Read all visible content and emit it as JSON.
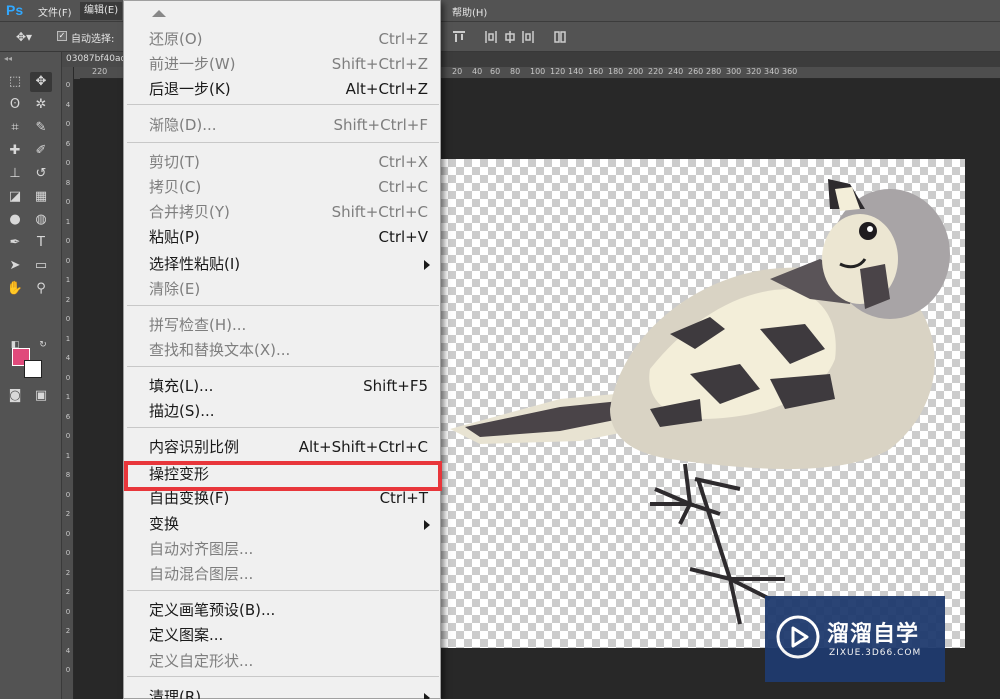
{
  "menubar": {
    "logo": "Ps",
    "items": [
      "文件(F)",
      "编辑(E)",
      "帮助(H)"
    ]
  },
  "options_bar": {
    "auto_select_label": "自动选择:"
  },
  "document_tab": {
    "title": "03087bf40ad"
  },
  "ruler_top": [
    "220",
    "20",
    "40",
    "60",
    "80",
    "100",
    "120",
    "140",
    "160",
    "180",
    "200",
    "220",
    "240",
    "260",
    "280",
    "300",
    "320",
    "340",
    "360"
  ],
  "ruler_left": [
    "0",
    "4",
    "0",
    "6",
    "0",
    "8",
    "0",
    "1",
    "0",
    "0",
    "1",
    "2",
    "0",
    "1",
    "4",
    "0",
    "1",
    "6",
    "0",
    "1",
    "8",
    "0",
    "2",
    "0",
    "0",
    "2",
    "2",
    "0",
    "2",
    "4",
    "0"
  ],
  "edit_menu": {
    "items": [
      {
        "label": "还原(O)",
        "shortcut": "Ctrl+Z",
        "enabled": false
      },
      {
        "label": "前进一步(W)",
        "shortcut": "Shift+Ctrl+Z",
        "enabled": false
      },
      {
        "label": "后退一步(K)",
        "shortcut": "Alt+Ctrl+Z",
        "enabled": true
      },
      {
        "label": "渐隐(D)...",
        "shortcut": "Shift+Ctrl+F",
        "enabled": false
      },
      {
        "label": "剪切(T)",
        "shortcut": "Ctrl+X",
        "enabled": false
      },
      {
        "label": "拷贝(C)",
        "shortcut": "Ctrl+C",
        "enabled": false
      },
      {
        "label": "合并拷贝(Y)",
        "shortcut": "Shift+Ctrl+C",
        "enabled": false
      },
      {
        "label": "粘贴(P)",
        "shortcut": "Ctrl+V",
        "enabled": true
      },
      {
        "label": "选择性粘贴(I)",
        "shortcut": "",
        "enabled": true,
        "submenu": true
      },
      {
        "label": "清除(E)",
        "shortcut": "",
        "enabled": false
      },
      {
        "label": "拼写检查(H)...",
        "shortcut": "",
        "enabled": false
      },
      {
        "label": "查找和替换文本(X)...",
        "shortcut": "",
        "enabled": false
      },
      {
        "label": "填充(L)...",
        "shortcut": "Shift+F5",
        "enabled": true
      },
      {
        "label": "描边(S)...",
        "shortcut": "",
        "enabled": true
      },
      {
        "label": "内容识别比例",
        "shortcut": "Alt+Shift+Ctrl+C",
        "enabled": true
      },
      {
        "label": "操控变形",
        "shortcut": "",
        "enabled": true,
        "highlighted": true
      },
      {
        "label": "自由变换(F)",
        "shortcut": "Ctrl+T",
        "enabled": true
      },
      {
        "label": "变换",
        "shortcut": "",
        "enabled": true,
        "submenu": true
      },
      {
        "label": "自动对齐图层...",
        "shortcut": "",
        "enabled": false
      },
      {
        "label": "自动混合图层...",
        "shortcut": "",
        "enabled": false
      },
      {
        "label": "定义画笔预设(B)...",
        "shortcut": "",
        "enabled": true
      },
      {
        "label": "定义图案...",
        "shortcut": "",
        "enabled": true
      },
      {
        "label": "定义自定形状...",
        "shortcut": "",
        "enabled": false
      },
      {
        "label": "清理(R)",
        "shortcut": "",
        "enabled": true,
        "submenu": true
      }
    ]
  },
  "colors": {
    "foreground": "#e04a7b",
    "background": "#ffffff",
    "highlight_border": "#e8363b"
  },
  "watermark": {
    "title": "溜溜自学",
    "url": "ZIXUE.3D66.COM"
  }
}
